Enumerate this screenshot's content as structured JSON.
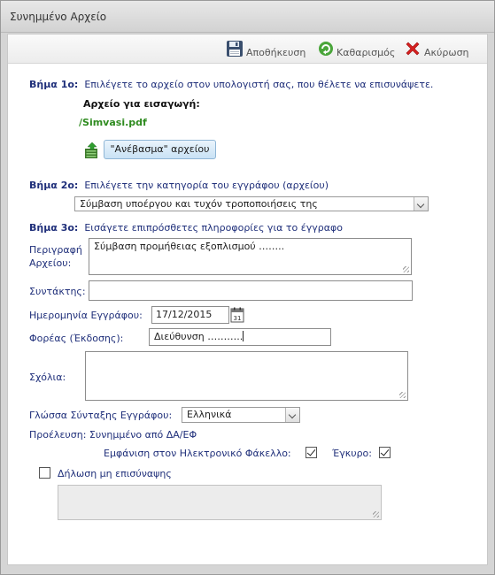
{
  "dialog": {
    "title": "Συνημμένο Αρχείο"
  },
  "toolbar": {
    "save_label": "Αποθήκευση",
    "reset_label": "Καθαρισμός",
    "cancel_label": "Ακύρωση"
  },
  "step1": {
    "prefix": "Βήμα 1ο:",
    "text": "Επιλέγετε το αρχείο στον υπολογιστή σας, που θέλετε να επισυνάψετε.",
    "file_heading": "Αρχείο για εισαγωγή:",
    "file_name": "/Simvasi.pdf",
    "upload_label": "\"Ανέβασμα\" αρχείου"
  },
  "step2": {
    "prefix": "Βήμα 2ο:",
    "text": "Επιλέγετε την κατηγορία του εγγράφου (αρχείου)",
    "category_value": "Σύμβαση υποέργου και τυχόν τροποποιήσεις της"
  },
  "step3": {
    "prefix": "Βήμα 3ο:",
    "text": "Εισάγετε επιπρόσθετες πληροφορίες για το έγγραφο"
  },
  "form": {
    "description_label_1": "Περιγραφή",
    "description_label_2": "Αρχείου:",
    "description_value": "Σύμβαση προμήθειας εξοπλισμού ……..",
    "author_label": "Συντάκτης:",
    "author_value": "",
    "date_label": "Ημερομηνία Εγγράφου:",
    "date_value": "17/12/2015",
    "issuer_label": "Φορέας (Έκδοσης):",
    "issuer_value": "Διεύθυνση ………..",
    "comments_label": "Σχόλια:",
    "comments_value": "",
    "language_label": "Γλώσσα Σύνταξης Εγγράφου:",
    "language_value": "Ελληνικά",
    "origin_label": "Προέλευση:",
    "origin_value": "Συνημμένο από ΔΑ/ΕΦ",
    "show_in_folder_label": "Εμφάνιση στον Ηλεκτρονικό Φάκελλο:",
    "show_in_folder_checked": true,
    "valid_label": "Έγκυρο:",
    "valid_checked": true,
    "no_attach_label": "Δήλωση μη επισύναψης",
    "no_attach_checked": false,
    "no_attach_reason_value": ""
  },
  "colors": {
    "step_text": "#1f2f7a",
    "file_name": "#2e8b1f",
    "cancel_red": "#d62020"
  }
}
